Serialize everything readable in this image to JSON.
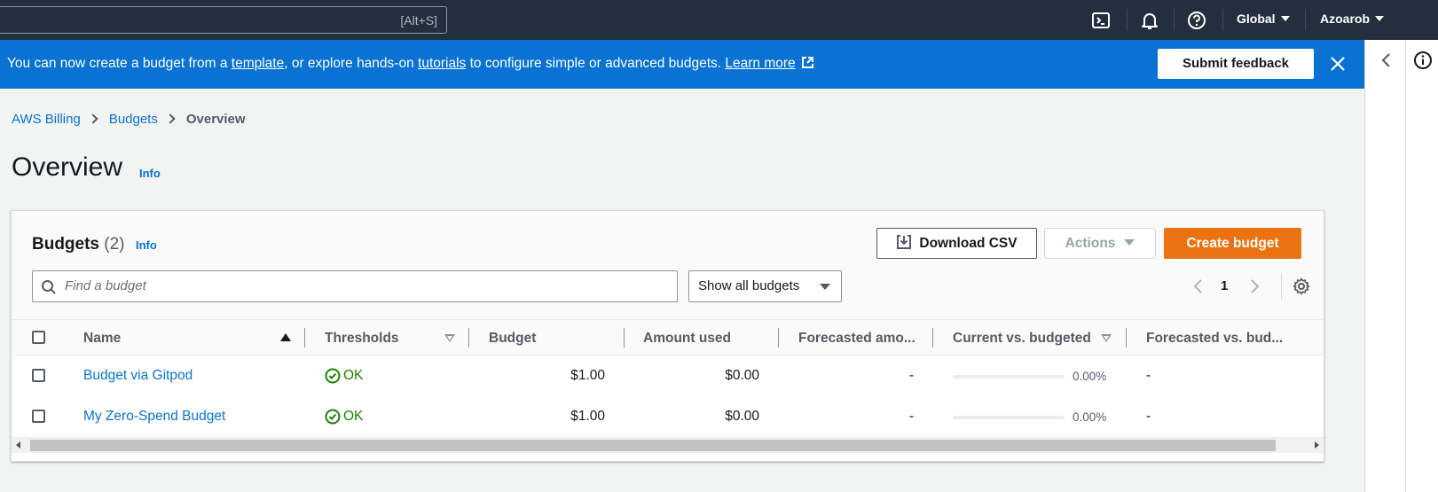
{
  "topnav": {
    "search_hint": "[Alt+S]",
    "region": "Global",
    "user": "Azoarob",
    "icons": [
      "cloudshell-icon",
      "notifications-icon",
      "help-icon"
    ]
  },
  "banner": {
    "text_1": "You can now create a budget from a ",
    "link_template": "template",
    "text_2": ", or explore hands-on ",
    "link_tutorials": "tutorials",
    "text_3": " to configure simple or advanced budgets. ",
    "link_learn": "Learn more",
    "feedback_label": "Submit feedback",
    "color": "#0972d3"
  },
  "breadcrumb": {
    "items": [
      "AWS Billing",
      "Budgets",
      "Overview"
    ]
  },
  "page": {
    "title": "Overview",
    "info": "Info"
  },
  "budgets": {
    "title": "Budgets",
    "count": "(2)",
    "info": "Info",
    "download_label": "Download CSV",
    "actions_label": "Actions",
    "create_label": "Create budget",
    "search_placeholder": "Find a budget",
    "filter_value": "Show all budgets",
    "page": "1",
    "accent": "#ec7211"
  },
  "table": {
    "columns": [
      "Name",
      "Thresholds",
      "Budget",
      "Amount used",
      "Forecasted amo...",
      "Current vs. budgeted",
      "Forecasted vs. bud..."
    ],
    "rows": [
      {
        "name": "Budget via Gitpod",
        "threshold": "OK",
        "budget": "$1.00",
        "used": "$0.00",
        "forecast": "-",
        "current_pct": "0.00%",
        "current_fraction": 0,
        "forecast_vs": "-"
      },
      {
        "name": "My Zero-Spend Budget",
        "threshold": "OK",
        "budget": "$1.00",
        "used": "$0.00",
        "forecast": "-",
        "current_pct": "0.00%",
        "current_fraction": 0,
        "forecast_vs": "-"
      }
    ]
  }
}
